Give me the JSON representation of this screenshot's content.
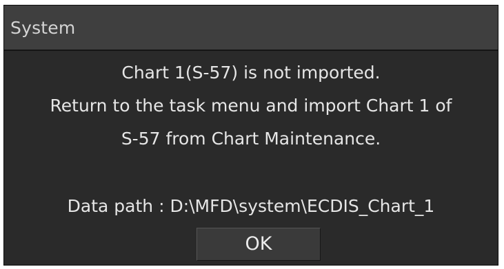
{
  "dialog": {
    "title": "System",
    "message_lines": [
      "Chart 1(S-57) is not imported.",
      "Return to the task menu and import Chart 1 of",
      "S-57 from Chart Maintenance."
    ],
    "data_path_line": "Data path : D:\\MFD\\system\\ECDIS_Chart_1",
    "ok_label": "OK"
  },
  "colors": {
    "dialog_background": "#2a2a2a",
    "titlebar_background": "#3f3f3f",
    "text": "#e6e6e6",
    "button_background": "#3a3a3a"
  }
}
